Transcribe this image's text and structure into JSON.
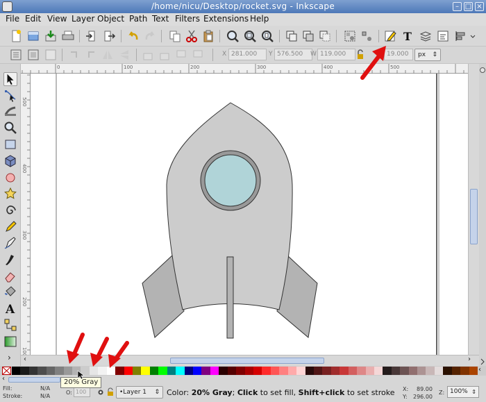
{
  "window": {
    "title": "/home/nicu/Desktop/rocket.svg - Inkscape",
    "buttons": [
      "–",
      "□",
      "×"
    ]
  },
  "menubar": {
    "items": [
      "File",
      "Edit",
      "View",
      "Layer",
      "Object",
      "Path",
      "Text",
      "Filters",
      "Extensions",
      "Help"
    ]
  },
  "commands_toolbar": {
    "icons": [
      "new-document-icon",
      "open-icon",
      "save-icon",
      "print-icon",
      "import-icon",
      "export-icon",
      "undo-icon",
      "redo-icon",
      "copy-icon",
      "cut-icon",
      "paste-icon",
      "zoom-selection-icon",
      "zoom-drawing-icon",
      "zoom-page-icon",
      "duplicate-icon",
      "clone-icon",
      "unlink-clone-icon",
      "group-icon",
      "ungroup-icon",
      "fill-stroke-icon",
      "text-font-icon",
      "layers-icon",
      "xml-editor-icon",
      "align-icon"
    ]
  },
  "controls_toolbar": {
    "x_label": "X",
    "x_value": "281.000",
    "y_label": "Y",
    "y_value": "576.500",
    "w_label": "W",
    "w_value": "119.000",
    "h_value": "19.000",
    "unit": "px"
  },
  "rulers": {
    "h_labels": [
      "0",
      "100",
      "200",
      "300",
      "400",
      "500"
    ],
    "v_labels": [
      "500",
      "400",
      "300",
      "200",
      "100"
    ]
  },
  "palette": {
    "colors": [
      "#000000",
      "#1a1a1a",
      "#333333",
      "#4d4d4d",
      "#666666",
      "#808080",
      "#999999",
      "#b3b3b3",
      "#cccccc",
      "#e6e6e6",
      "#f2f2f2",
      "#ffffff",
      "#800000",
      "#ff0000",
      "#808000",
      "#ffff00",
      "#008000",
      "#00ff00",
      "#008080",
      "#00ffff",
      "#000080",
      "#0000ff",
      "#800080",
      "#ff00ff",
      "#2b0000",
      "#550000",
      "#800000",
      "#aa0000",
      "#d40000",
      "#ff2a2a",
      "#ff5555",
      "#ff8080",
      "#ffaaaa",
      "#ffd5d5",
      "#280b0b",
      "#501616",
      "#782121",
      "#a02c2c",
      "#c83737",
      "#d35f5f",
      "#de8787",
      "#e9afaf",
      "#f4d7d7",
      "#241c1c",
      "#483737",
      "#6c5353",
      "#916f6f",
      "#ac9393",
      "#c8b7b7",
      "#e3dbdb",
      "#2b1100",
      "#552200",
      "#803300",
      "#aa4400"
    ]
  },
  "tooltip": "20% Gray",
  "status": {
    "fill_label": "Fill:",
    "fill_value": "N/A",
    "stroke_label": "Stroke:",
    "stroke_value": "N/A",
    "opacity_label": "O:",
    "opacity_value": "100",
    "layer": "•Layer 1",
    "msg_prefix": "Color: ",
    "msg_color": "20% Gray",
    "msg_mid": "; ",
    "msg_click": "Click",
    "msg_fill": " to set fill, ",
    "msg_shift": "Shift+click",
    "msg_stroke": " to set stroke",
    "x_label": "X:",
    "x_value": "89.00",
    "y_label": "Y:",
    "y_value": "296.00",
    "z_label": "Z:",
    "zoom": "100%"
  }
}
